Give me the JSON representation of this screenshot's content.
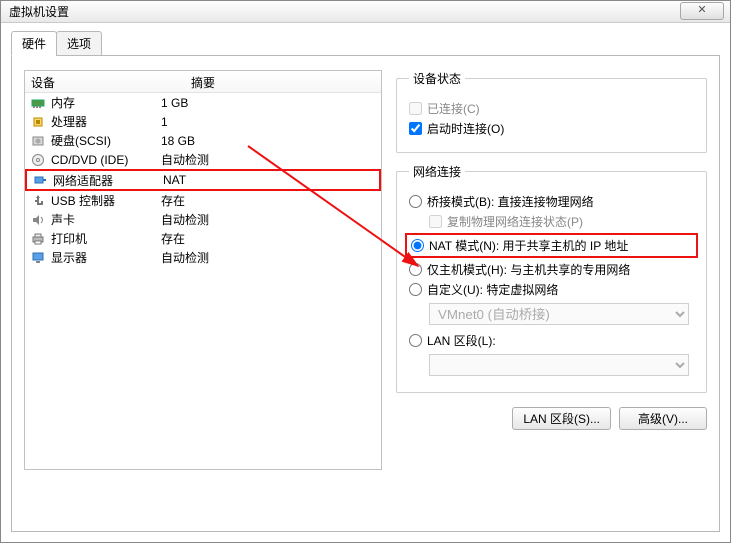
{
  "window": {
    "title": "虚拟机设置"
  },
  "tabs": {
    "hardware": "硬件",
    "options": "选项"
  },
  "list": {
    "head_device": "设备",
    "head_summary": "摘要",
    "rows": [
      {
        "name": "内存",
        "summary": "1 GB",
        "icon": "memory"
      },
      {
        "name": "处理器",
        "summary": "1",
        "icon": "cpu"
      },
      {
        "name": "硬盘(SCSI)",
        "summary": "18 GB",
        "icon": "disk"
      },
      {
        "name": "CD/DVD (IDE)",
        "summary": "自动检测",
        "icon": "cd"
      },
      {
        "name": "网络适配器",
        "summary": "NAT",
        "icon": "net",
        "selected": true
      },
      {
        "name": "USB 控制器",
        "summary": "存在",
        "icon": "usb"
      },
      {
        "name": "声卡",
        "summary": "自动检测",
        "icon": "sound"
      },
      {
        "name": "打印机",
        "summary": "存在",
        "icon": "printer"
      },
      {
        "name": "显示器",
        "summary": "自动检测",
        "icon": "display"
      }
    ]
  },
  "device_state": {
    "legend": "设备状态",
    "connected": "已连接(C)",
    "connect_on_power": "启动时连接(O)"
  },
  "net": {
    "legend": "网络连接",
    "bridged": "桥接模式(B): 直接连接物理网络",
    "replicate": "复制物理网络连接状态(P)",
    "nat": "NAT 模式(N): 用于共享主机的 IP 地址",
    "hostonly": "仅主机模式(H): 与主机共享的专用网络",
    "custom": "自定义(U): 特定虚拟网络",
    "custom_combo": "VMnet0 (自动桥接)",
    "lan": "LAN 区段(L):",
    "lan_combo": ""
  },
  "buttons": {
    "lan_seg": "LAN 区段(S)...",
    "advanced": "高级(V)..."
  }
}
